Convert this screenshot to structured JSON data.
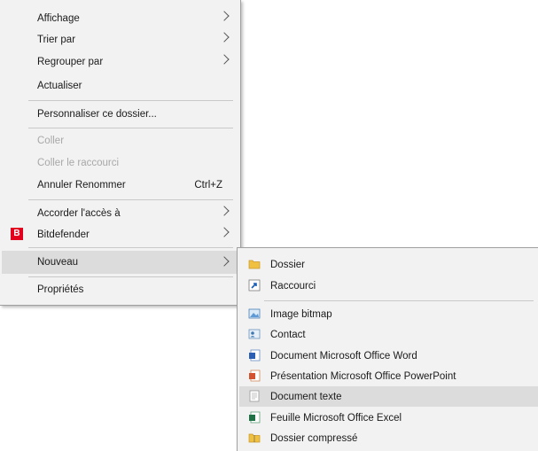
{
  "context_menu": {
    "items": [
      {
        "label": "Affichage"
      },
      {
        "label": "Trier par"
      },
      {
        "label": "Regrouper par"
      },
      {
        "label": "Actualiser"
      },
      {
        "label": "Personnaliser ce dossier..."
      },
      {
        "label": "Coller"
      },
      {
        "label": "Coller le raccourci"
      },
      {
        "label": "Annuler Renommer",
        "shortcut": "Ctrl+Z"
      },
      {
        "label": "Accorder l'accès à"
      },
      {
        "label": "Bitdefender"
      },
      {
        "label": "Nouveau"
      },
      {
        "label": "Propriétés"
      }
    ]
  },
  "submenu_new": {
    "items": [
      {
        "label": "Dossier",
        "icon": "folder-icon"
      },
      {
        "label": "Raccourci",
        "icon": "shortcut-icon"
      },
      {
        "label": "Image bitmap",
        "icon": "bitmap-icon"
      },
      {
        "label": "Contact",
        "icon": "contact-icon"
      },
      {
        "label": "Document Microsoft Office Word",
        "icon": "word-icon"
      },
      {
        "label": "Présentation Microsoft Office PowerPoint",
        "icon": "powerpoint-icon"
      },
      {
        "label": "Document texte",
        "icon": "text-document-icon"
      },
      {
        "label": "Feuille Microsoft Office Excel",
        "icon": "excel-icon"
      },
      {
        "label": "Dossier compressé",
        "icon": "zip-folder-icon"
      }
    ]
  },
  "colors": {
    "menu_background": "#f2f2f2",
    "highlight": "#dcdcdc",
    "disabled_text": "#a8a8a8",
    "bitdefender_red": "#e1001e"
  }
}
